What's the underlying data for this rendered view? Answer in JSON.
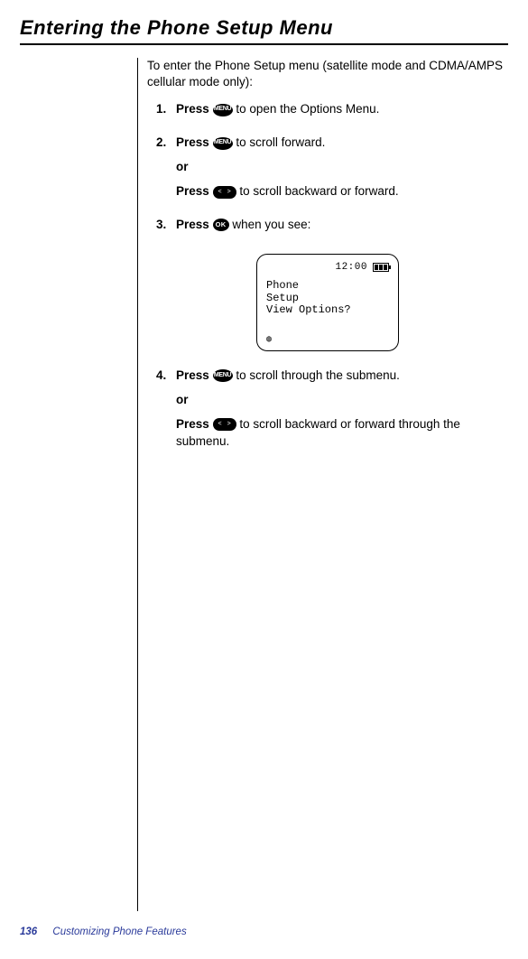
{
  "heading": "Entering the Phone Setup Menu",
  "intro": "To enter the Phone Setup menu (satellite mode and CDMA/AMPS cellular mode only):",
  "keys": {
    "menu": "MENU",
    "ok": "OK"
  },
  "steps": {
    "s1": {
      "num": "1.",
      "press": "Press",
      "tail": " to open the Options Menu."
    },
    "s2": {
      "num": "2.",
      "press": "Press",
      "tail": " to scroll forward.",
      "or": "or",
      "press2": "Press",
      "tail2": " to scroll backward or forward."
    },
    "s3": {
      "num": "3.",
      "press": "Press",
      "tail": " when you see:"
    },
    "s4": {
      "num": "4.",
      "press": "Press",
      "tail": " to scroll through the submenu.",
      "or": "or",
      "press2": "Press",
      "tail2": " to scroll backward or forward through the submenu."
    }
  },
  "screen": {
    "time": "12:00",
    "line1": "Phone",
    "line2": "Setup",
    "line3": "View Options?",
    "signal": "◍"
  },
  "footer": {
    "page": "136",
    "chapter": "Customizing Phone Features"
  }
}
